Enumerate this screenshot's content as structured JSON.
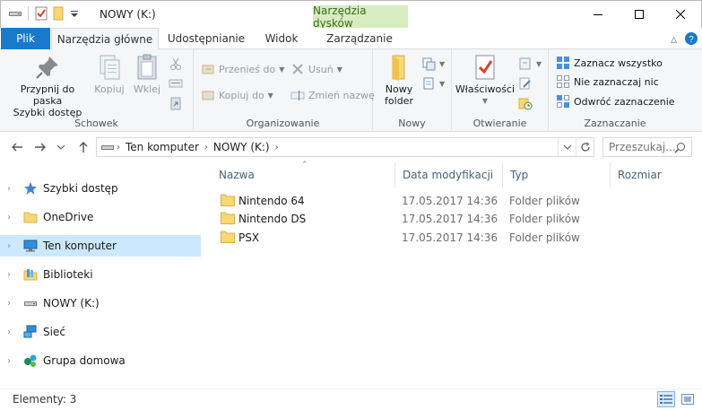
{
  "window": {
    "title": "NOWY (K:)",
    "context_tab_header": "Narzędzia dysków"
  },
  "ribbon_tabs": {
    "file": "Plik",
    "home": "Narzędzia główne",
    "share": "Udostępnianie",
    "view": "Widok",
    "manage": "Zarządzanie"
  },
  "ribbon": {
    "clipboard": {
      "label": "Schowek",
      "pin_line1": "Przypnij do paska",
      "pin_line2": "Szybki dostęp",
      "copy": "Kopiuj",
      "paste": "Wklej"
    },
    "organize": {
      "label": "Organizowanie",
      "move_to": "Przenieś do",
      "copy_to": "Kopiuj do",
      "delete": "Usuń",
      "rename": "Zmień nazwę"
    },
    "new": {
      "label": "Nowy",
      "new_folder_line1": "Nowy",
      "new_folder_line2": "folder"
    },
    "open": {
      "label": "Otwieranie",
      "properties": "Właściwości"
    },
    "select": {
      "label": "Zaznaczanie",
      "select_all": "Zaznacz wszystko",
      "select_none": "Nie zaznaczaj nic",
      "invert": "Odwróć zaznaczenie"
    }
  },
  "address": {
    "crumbs": [
      "Ten komputer",
      "NOWY (K:)"
    ],
    "search_placeholder": "Przeszukaj..."
  },
  "nav_pane": {
    "items": [
      {
        "label": "Szybki dostęp",
        "icon": "star-icon"
      },
      {
        "label": "OneDrive",
        "icon": "folder-icon"
      },
      {
        "label": "Ten komputer",
        "icon": "computer-icon",
        "selected": true
      },
      {
        "label": "Biblioteki",
        "icon": "library-icon"
      },
      {
        "label": "NOWY (K:)",
        "icon": "drive-icon"
      },
      {
        "label": "Sieć",
        "icon": "network-icon"
      },
      {
        "label": "Grupa domowa",
        "icon": "homegroup-icon"
      }
    ]
  },
  "file_list": {
    "columns": {
      "name": "Nazwa",
      "date": "Data modyfikacji",
      "type": "Typ",
      "size": "Rozmiar"
    },
    "rows": [
      {
        "name": "Nintendo 64",
        "date": "17.05.2017 14:36",
        "type": "Folder plików"
      },
      {
        "name": "Nintendo DS",
        "date": "17.05.2017 14:36",
        "type": "Folder plików"
      },
      {
        "name": "PSX",
        "date": "17.05.2017 14:36",
        "type": "Folder plików"
      }
    ]
  },
  "status": {
    "items_text": "Elementy: 3"
  },
  "colors": {
    "file_tab": "#1979ca",
    "context_tab": "#d7ecc0",
    "selection": "#cce8ff",
    "folder": "#f8d775"
  }
}
